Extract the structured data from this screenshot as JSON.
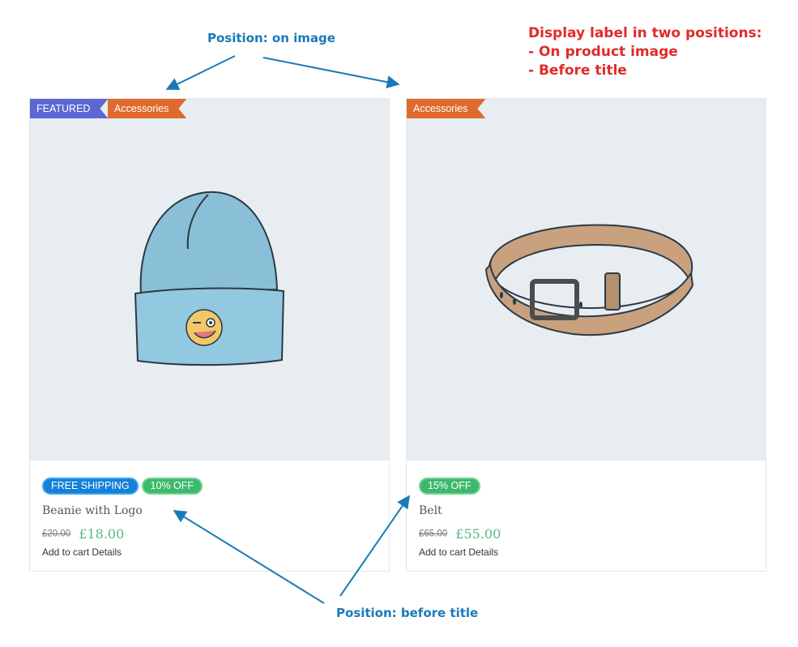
{
  "annotations": {
    "top_label": "Position: on image",
    "bottom_label": "Position: before title",
    "note_lines": [
      "Display label in two positions:",
      "- On product image",
      "- Before title"
    ]
  },
  "products": [
    {
      "ribbons": [
        "FEATURED",
        "Accessories"
      ],
      "badges": [
        "FREE SHIPPING",
        "10% OFF"
      ],
      "title": "Beanie with Logo",
      "old_price": "£20.00",
      "price": "£18.00",
      "add_to_cart": "Add to cart",
      "details": "Details"
    },
    {
      "ribbons": [
        "Accessories"
      ],
      "badges": [
        "15% OFF"
      ],
      "title": "Belt",
      "old_price": "£65.00",
      "price": "£55.00",
      "add_to_cart": "Add to cart",
      "details": "Details"
    }
  ],
  "colors": {
    "featured_ribbon": "#5c67d3",
    "category_ribbon": "#e06a2c",
    "free_shipping_badge": "#1580d8",
    "discount_badge": "#3cb96b",
    "annotation_blue": "#1a7ab8",
    "annotation_red": "#e22a2a",
    "price_green": "#56b97d"
  }
}
